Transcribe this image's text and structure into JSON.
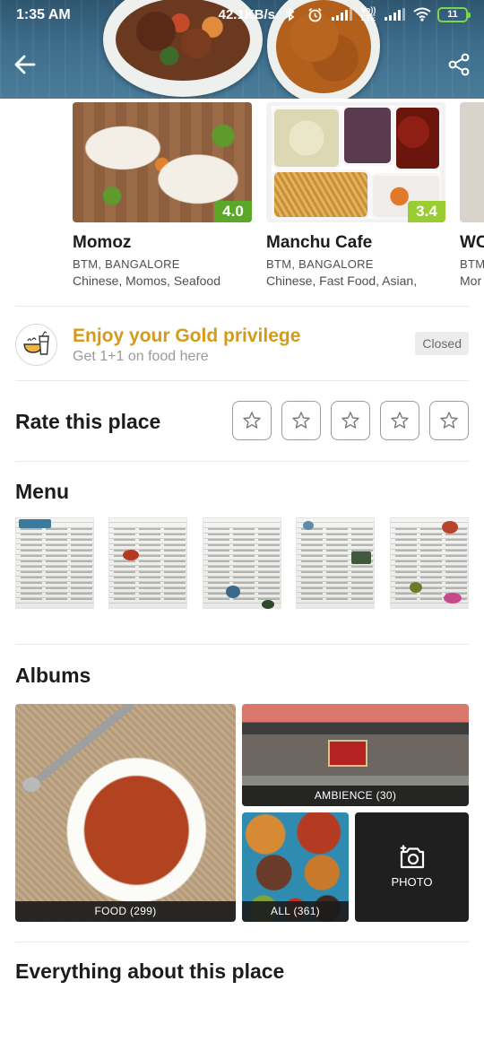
{
  "status_bar": {
    "time": "1:35 AM",
    "net_speed": "42.1KB/s",
    "volte": "Vo)) LTE",
    "battery": "11"
  },
  "nearby": [
    {
      "name": "Momoz",
      "location": "BTM, BANGALORE",
      "cuisines": "Chinese, Momos, Seafood",
      "rating": "4.0",
      "rating_color": "#5ba829"
    },
    {
      "name": "Manchu Cafe",
      "location": "BTM, BANGALORE",
      "cuisines": "Chinese, Fast Food, Asian,",
      "rating": "3.4",
      "rating_color": "#9acd32"
    },
    {
      "name": "WC",
      "location": "BTM",
      "cuisines": "Mor"
    }
  ],
  "gold": {
    "title": "Enjoy your Gold privilege",
    "subtitle": "Get 1+1 on food here",
    "status": "Closed",
    "accent_color": "#d39b1b"
  },
  "rate": {
    "title": "Rate this place",
    "stars": [
      "star-1",
      "star-2",
      "star-3",
      "star-4",
      "star-5"
    ]
  },
  "menu": {
    "title": "Menu",
    "pages": [
      "menu-page-1",
      "menu-page-2",
      "menu-page-3",
      "menu-page-4",
      "menu-page-5"
    ]
  },
  "albums": {
    "title": "Albums",
    "food": "FOOD (299)",
    "ambience": "AMBIENCE (30)",
    "all": "ALL (361)",
    "photo": "PHOTO"
  },
  "about": {
    "title": "Everything about this place"
  }
}
